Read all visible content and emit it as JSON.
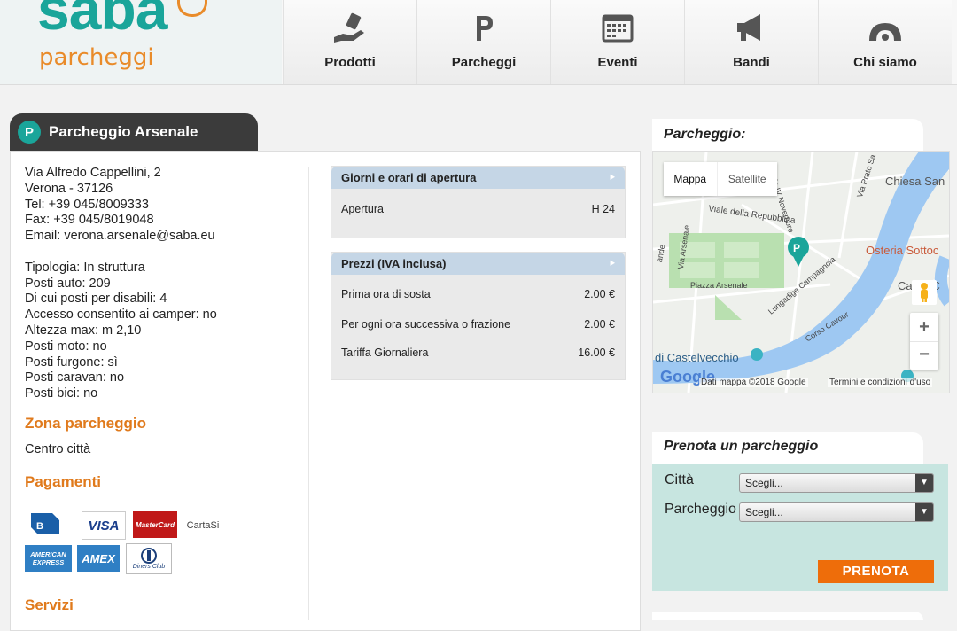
{
  "brand": {
    "name": "saba",
    "sub": "parcheggi",
    "primary": "#1aa59a",
    "accent": "#e98b2a"
  },
  "nav": [
    {
      "label": "Prodotti",
      "icon": "hand-card-icon"
    },
    {
      "label": "Parcheggi",
      "icon": "parking-p-icon"
    },
    {
      "label": "Eventi",
      "icon": "calendar-icon"
    },
    {
      "label": "Bandi",
      "icon": "megaphone-icon"
    },
    {
      "label": "Chi siamo",
      "icon": "car-logo-icon"
    }
  ],
  "parking": {
    "title": "Parcheggio Arsenale",
    "address": [
      "Via Alfredo Cappellini, 2",
      "Verona - 37126",
      "Tel: +39 045/8009333",
      "Fax: +39 045/8019048",
      "Email: verona.arsenale@saba.eu"
    ],
    "details": [
      "Tipologia: In struttura",
      "Posti auto: 209",
      "Di cui posti per disabili: 4",
      "Accesso consentito ai camper: no",
      "Altezza max: m 2,10",
      "Posti moto: no",
      "Posti furgone: sì",
      "Posti caravan: no",
      "Posti bici: no"
    ]
  },
  "zona": {
    "title": "Zona parcheggio",
    "value": "Centro città"
  },
  "pagamenti": {
    "title": "Pagamenti",
    "cards": [
      "VISA",
      "MasterCard",
      "CartaSi",
      "AMERICAN EXPRESS",
      "AMEX",
      "Diners Club"
    ]
  },
  "servizi": {
    "title": "Servizi"
  },
  "orari": {
    "title": "Giorni e orari di apertura",
    "rows": [
      {
        "label": "Apertura",
        "value": "H 24"
      }
    ]
  },
  "prezzi": {
    "title": "Prezzi (IVA inclusa)",
    "rows": [
      {
        "label": "Prima ora di sosta",
        "value": "2.00 €"
      },
      {
        "label": "Per ogni ora successiva o frazione",
        "value": "2.00 €"
      },
      {
        "label": "Tariffa Giornaliera",
        "value": "16.00 €"
      }
    ]
  },
  "map": {
    "title": "Parcheggio:",
    "tabs": [
      "Mappa",
      "Satellite"
    ],
    "labels": [
      "Viale della Repubblica",
      "Via IV Novembre",
      "Via Prato Sa",
      "Chiesa San",
      "Osteria Sottoc",
      "Ca",
      "i C",
      "Piazza Arsenale",
      "Lungadige Campagnola",
      "Via Arsenale",
      "Corso Cavour",
      "di Castelvecchio",
      "ande"
    ],
    "attribution": "Dati mappa ©2018 Google",
    "terms": "Termini e condizioni d'uso",
    "google": "Google",
    "zoom_in": "+",
    "zoom_out": "−"
  },
  "booking": {
    "title": "Prenota un parcheggio",
    "city_label": "Città",
    "parking_label": "Parcheggio",
    "select_placeholder": "Scegli...",
    "submit": "PRENOTA",
    "submit_color": "#ee6d0a"
  }
}
